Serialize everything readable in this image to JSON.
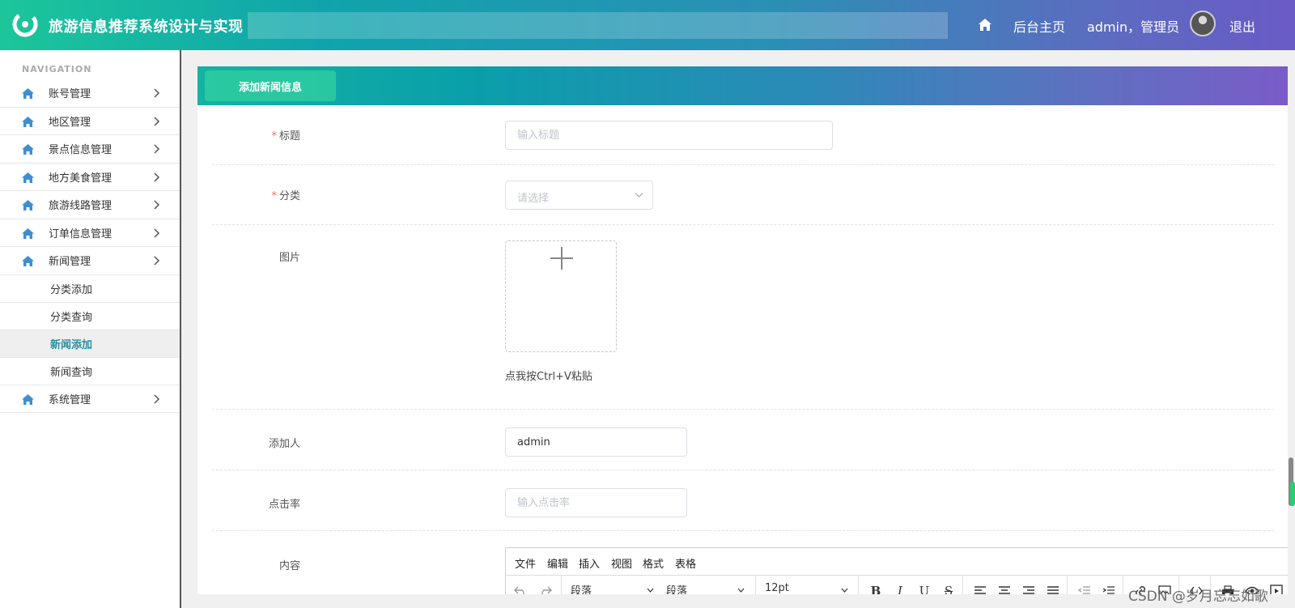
{
  "header": {
    "title": "旅游信息推荐系统设计与实现",
    "home_link": "后台主页",
    "user": "admin，管理员",
    "logout": "退出"
  },
  "sidebar": {
    "nav_label": "NAVIGATION",
    "items": [
      {
        "label": "账号管理"
      },
      {
        "label": "地区管理"
      },
      {
        "label": "景点信息管理"
      },
      {
        "label": "地方美食管理"
      },
      {
        "label": "旅游线路管理"
      },
      {
        "label": "订单信息管理"
      },
      {
        "label": "新闻管理"
      }
    ],
    "sub_items": [
      {
        "label": "分类添加"
      },
      {
        "label": "分类查询"
      },
      {
        "label": "新闻添加",
        "active": true
      },
      {
        "label": "新闻查询"
      }
    ],
    "last_item": {
      "label": "系统管理"
    }
  },
  "main": {
    "add_button": "添加新闻信息",
    "form": {
      "title_label": "标题",
      "title_placeholder": "输入标题",
      "category_label": "分类",
      "category_placeholder": "请选择",
      "image_label": "图片",
      "paste_hint": "点我按Ctrl+V粘贴",
      "adder_label": "添加人",
      "adder_value": "admin",
      "clicks_label": "点击率",
      "clicks_placeholder": "输入点击率",
      "content_label": "内容"
    },
    "editor": {
      "menus": [
        "文件",
        "编辑",
        "插入",
        "视图",
        "格式",
        "表格"
      ],
      "block_format": "段落",
      "font_family": "段落",
      "font_size": "12pt"
    }
  },
  "watermark": "CSDN @岁月忘忘如歌",
  "colors": {
    "accent": "#2a8fa0",
    "required": "#f56c6c",
    "header_start": "#1cc69a",
    "header_end": "#6a5bc6"
  }
}
